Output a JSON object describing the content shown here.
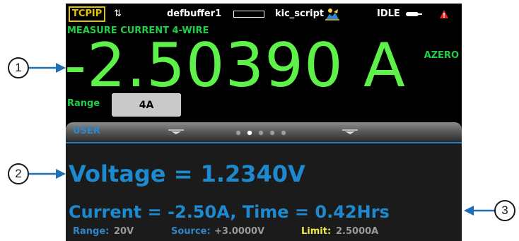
{
  "status_bar": {
    "comm": "TCPIP",
    "comm_arrows": "⇅",
    "buffer": "defbuffer1",
    "script": "kic_script",
    "trigger_state": "IDLE"
  },
  "measure": {
    "function": "MEASURE CURRENT 4-WIRE",
    "reading": "-2.50390 A",
    "azero": "AZERO",
    "range_label": "Range",
    "range_value": "4A"
  },
  "swipe": {
    "title": "USER",
    "page_count": 5,
    "active_page": 2,
    "line1": "Voltage = 1.2340V",
    "line2": "Current = -2.50A, Time = 0.42Hrs",
    "status": {
      "range_label": "Range:",
      "range_value": "20V",
      "source_label": "Source:",
      "source_value": "+3.0000V",
      "limit_label": "Limit:",
      "limit_value": "2.5000A"
    }
  },
  "callouts": {
    "one": "1",
    "two": "2",
    "three": "3"
  },
  "colors": {
    "measure_green": "#5ef14a",
    "label_green": "#1ecf46",
    "user_blue": "#1d8ad0",
    "limit_yellow": "#f0e94d",
    "comm_yellow": "#e5c200"
  },
  "icons": {
    "comm_arrows": "up-down-arrows-icon",
    "buffer_bar": "buffer-fill-icon",
    "script": "script-running-icon",
    "trigger": "trigger-icon",
    "event": "warning-event-icon"
  }
}
